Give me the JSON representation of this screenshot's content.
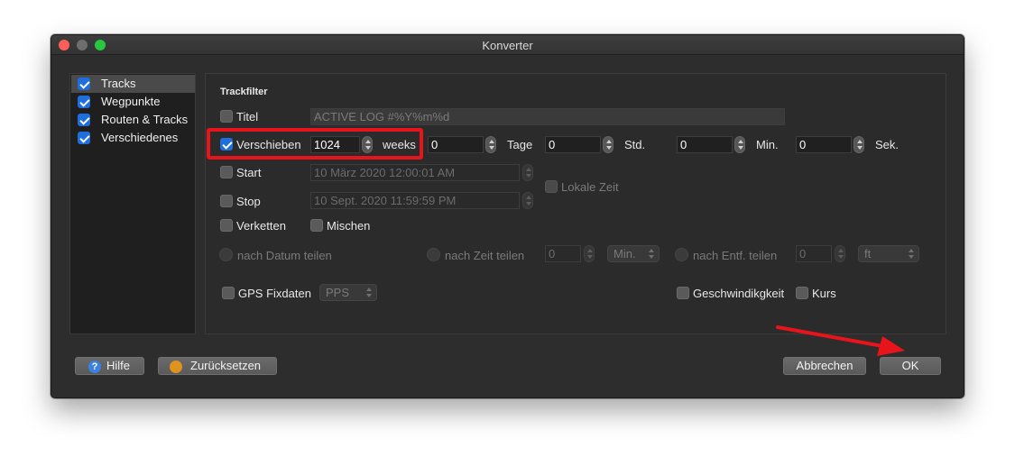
{
  "window": {
    "title": "Konverter",
    "traffic_light_colors": {
      "close": "#fc5f57",
      "minimize": "#6e6e6e",
      "zoom": "#27c840"
    }
  },
  "sidebar": {
    "items": [
      {
        "label": "Tracks",
        "checked": true,
        "selected": true
      },
      {
        "label": "Wegpunkte",
        "checked": true
      },
      {
        "label": "Routen & Tracks",
        "checked": true
      },
      {
        "label": "Verschiedenes",
        "checked": true
      }
    ]
  },
  "trackfilter": {
    "heading": "Trackfilter",
    "title": {
      "label": "Titel",
      "checked": false,
      "value": "ACTIVE LOG #%Y%m%d"
    },
    "shift": {
      "label": "Verschieben",
      "checked": true,
      "value": "1024",
      "unit": "weeks",
      "days_value": "0",
      "days_label": "Tage",
      "hours_value": "0",
      "hours_label": "Std.",
      "minutes_value": "0",
      "minutes_label": "Min.",
      "seconds_value": "0",
      "seconds_label": "Sek."
    },
    "start": {
      "label": "Start",
      "checked": false,
      "value": "10 März 2020 12:00:01 AM"
    },
    "stop": {
      "label": "Stop",
      "checked": false,
      "value": "10 Sept. 2020 11:59:59 PM"
    },
    "local_time": {
      "label": "Lokale Zeit",
      "checked": false
    },
    "merge": {
      "label": "Verketten",
      "checked": false
    },
    "mix": {
      "label": "Mischen",
      "checked": false
    },
    "split_date": {
      "label": "nach Datum teilen"
    },
    "split_time": {
      "label": "nach Zeit teilen",
      "value": "0",
      "unit": "Min."
    },
    "split_distance": {
      "label": "nach Entf. teilen",
      "value": "0",
      "unit": "ft"
    },
    "gps_fix": {
      "label": "GPS Fixdaten",
      "checked": false,
      "option": "PPS"
    },
    "speed": {
      "label": "Geschwindikgkeit",
      "checked": false
    },
    "course": {
      "label": "Kurs",
      "checked": false
    }
  },
  "buttons": {
    "help": "Hilfe",
    "reset": "Zurücksetzen",
    "cancel": "Abbrechen",
    "ok": "OK"
  },
  "annotation_colors": {
    "highlight": "#e8141b",
    "arrow": "#e8141b"
  }
}
